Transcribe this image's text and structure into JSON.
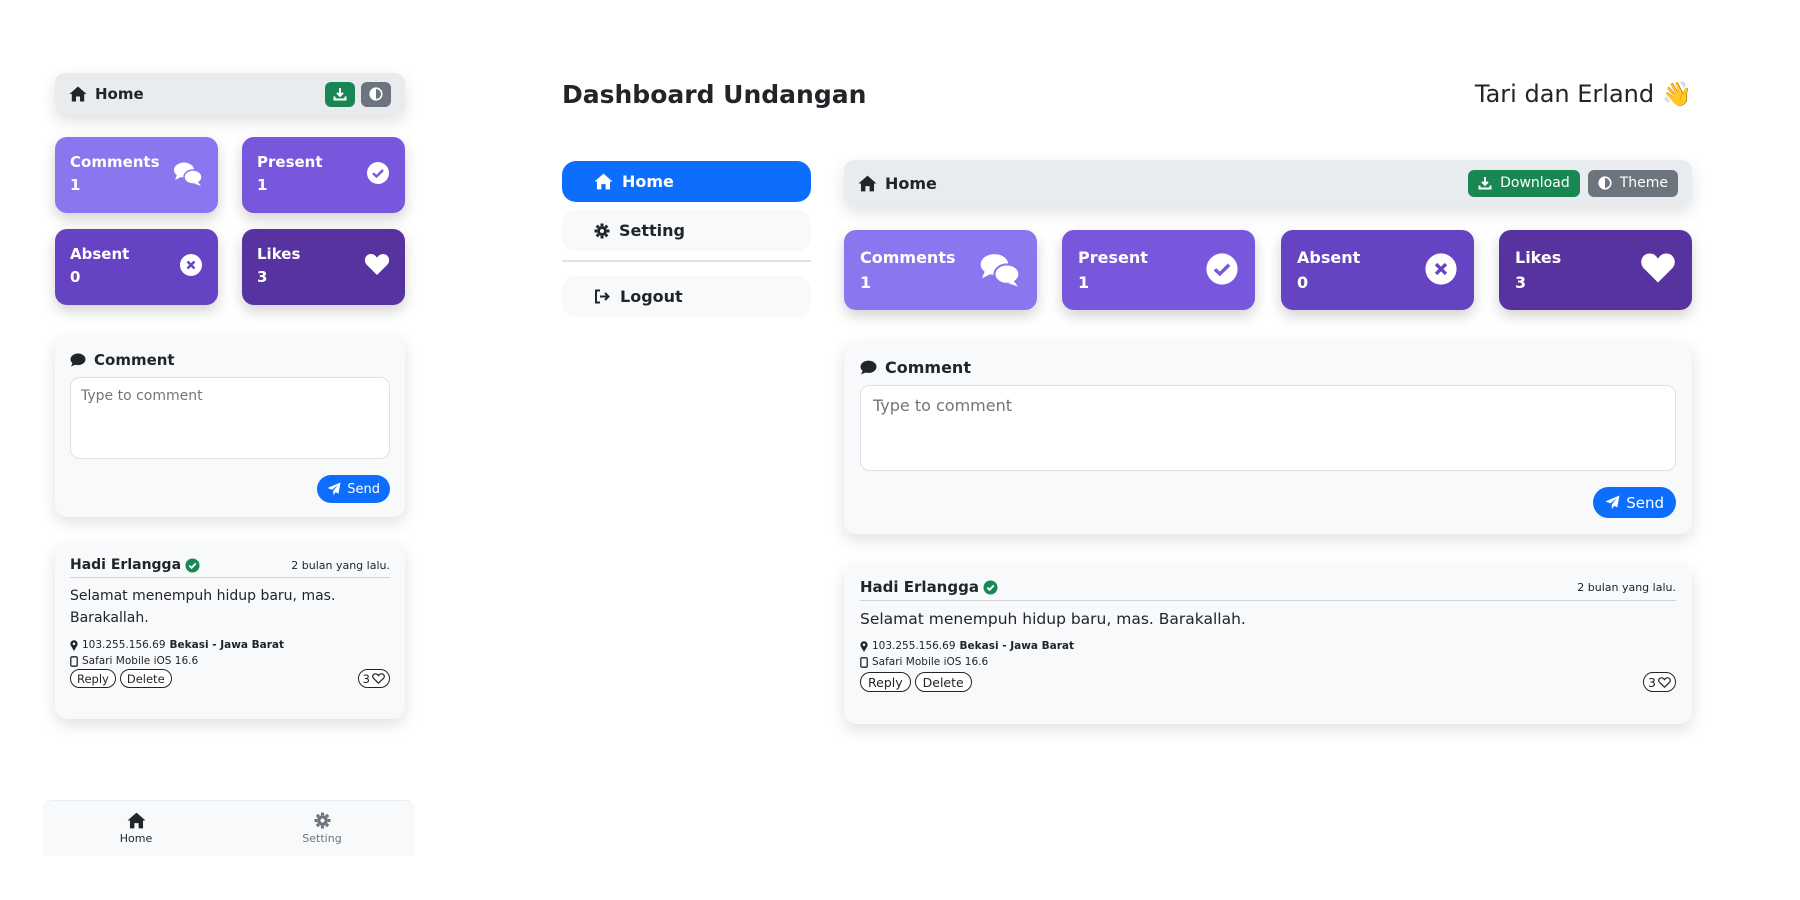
{
  "mobile": {
    "nav": {
      "title": "Home",
      "home_icon": "house-icon",
      "download_icon": "download-icon",
      "theme_icon": "contrast-icon"
    },
    "stats": [
      {
        "label": "Comments",
        "value": "1",
        "icon": "comments-icon"
      },
      {
        "label": "Present",
        "value": "1",
        "icon": "check-circle-icon"
      },
      {
        "label": "Absent",
        "value": "0",
        "icon": "x-circle-icon"
      },
      {
        "label": "Likes",
        "value": "3",
        "icon": "heart-icon"
      }
    ],
    "comment_form": {
      "title": "Comment",
      "placeholder": "Type to comment",
      "send_label": "Send"
    },
    "entry": {
      "name": "Hadi Erlangga",
      "time": "2 bulan yang lalu.",
      "text": "Selamat menempuh hidup baru, mas. Barakallah.",
      "ip": "103.255.156.69",
      "location": "Bekasi - Jawa Barat",
      "device": "Safari Mobile iOS 16.6",
      "reply_label": "Reply",
      "delete_label": "Delete",
      "likes": "3"
    },
    "bottom_nav": [
      {
        "label": "Home",
        "icon": "house-icon",
        "active": true
      },
      {
        "label": "Setting",
        "icon": "gear-icon",
        "active": false
      }
    ]
  },
  "desktop": {
    "title": "Dashboard Undangan",
    "user": "Tari dan Erland",
    "user_emoji": "👋",
    "sidebar": [
      {
        "label": "Home",
        "icon": "house-icon",
        "active": true
      },
      {
        "label": "Setting",
        "icon": "gear-icon",
        "active": false
      },
      {
        "label": "Logout",
        "icon": "logout-icon",
        "active": false
      }
    ],
    "nav": {
      "title": "Home",
      "download_label": "Download",
      "theme_label": "Theme"
    },
    "stats": [
      {
        "label": "Comments",
        "value": "1",
        "icon": "comments-icon"
      },
      {
        "label": "Present",
        "value": "1",
        "icon": "check-circle-icon"
      },
      {
        "label": "Absent",
        "value": "0",
        "icon": "x-circle-icon"
      },
      {
        "label": "Likes",
        "value": "3",
        "icon": "heart-icon"
      }
    ],
    "comment_form": {
      "title": "Comment",
      "placeholder": "Type to comment",
      "send_label": "Send"
    },
    "entry": {
      "name": "Hadi Erlangga",
      "time": "2 bulan yang lalu.",
      "text": "Selamat menempuh hidup baru, mas. Barakallah.",
      "ip": "103.255.156.69",
      "location": "Bekasi - Jawa Barat",
      "device": "Safari Mobile iOS 16.6",
      "reply_label": "Reply",
      "delete_label": "Delete",
      "likes": "3"
    }
  },
  "colors": {
    "primary": "#0d6efd",
    "success": "#198754",
    "secondary": "#6c757d",
    "stat_1": "#8a76ee",
    "stat_2": "#7957dc",
    "stat_3": "#6643c2",
    "stat_4": "#56339f"
  }
}
